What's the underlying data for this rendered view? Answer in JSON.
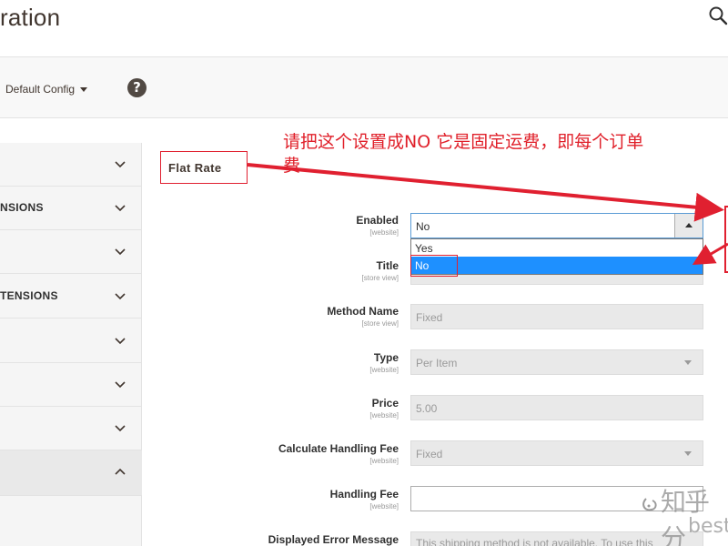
{
  "header": {
    "title": "ration",
    "search_icon": "search-icon"
  },
  "scope": {
    "switcher_label": "Default Config",
    "help_glyph": "?"
  },
  "sidebar": {
    "items": [
      {
        "label": "",
        "active": false
      },
      {
        "label": "NSIONS",
        "active": false
      },
      {
        "label": "",
        "active": false
      },
      {
        "label": "TENSIONS",
        "active": false
      },
      {
        "label": "",
        "active": false
      },
      {
        "label": "",
        "active": false
      },
      {
        "label": "",
        "active": false
      },
      {
        "label": "",
        "active": true
      }
    ]
  },
  "annotation": {
    "text": "请把这个设置成NO 它是固定运费，即每个订单",
    "text_line2": "费",
    "color": "#e0202a"
  },
  "section": {
    "title": "Flat Rate"
  },
  "fields": {
    "enabled": {
      "label": "Enabled",
      "scope": "[website]",
      "value": "No",
      "options": [
        "Yes",
        "No"
      ],
      "selected_option": "No"
    },
    "title": {
      "label": "Title",
      "scope": "[store view]",
      "value": ""
    },
    "method_name": {
      "label": "Method Name",
      "scope": "[store view]",
      "value": "Fixed"
    },
    "type": {
      "label": "Type",
      "scope": "[website]",
      "value": "Per Item"
    },
    "price": {
      "label": "Price",
      "scope": "[website]",
      "value": "5.00"
    },
    "calc_handling_fee": {
      "label": "Calculate Handling Fee",
      "scope": "[website]",
      "value": "Fixed"
    },
    "handling_fee": {
      "label": "Handling Fee",
      "scope": "[website]",
      "value": ""
    },
    "error_message": {
      "label": "Displayed Error Message",
      "value": "This shipping method is not available. To use this"
    }
  },
  "watermark": {
    "text": "知乎分",
    "sub": "best"
  },
  "colors": {
    "annotation_red": "#e0202a",
    "selection_blue": "#1e90ff"
  }
}
